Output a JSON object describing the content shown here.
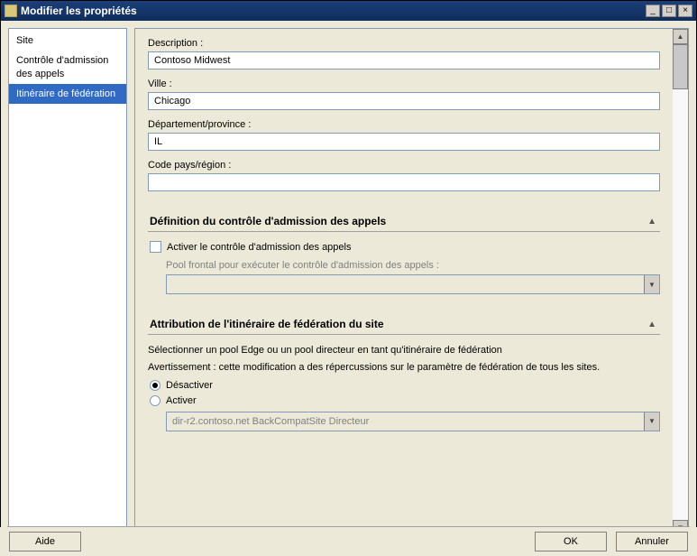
{
  "window": {
    "title": "Modifier les propriétés"
  },
  "sidebar": {
    "items": [
      {
        "label": "Site"
      },
      {
        "label": "Contrôle d'admission des appels"
      },
      {
        "label": "Itinéraire de fédération"
      }
    ]
  },
  "fields": {
    "description": {
      "label": "Description :",
      "value": "Contoso Midwest"
    },
    "city": {
      "label": "Ville :",
      "value": "Chicago"
    },
    "state": {
      "label": "Département/province :",
      "value": "IL"
    },
    "country": {
      "label": "Code pays/région :",
      "value": ""
    }
  },
  "cac": {
    "header": "Définition du contrôle d'admission des appels",
    "enable_label": "Activer le contrôle d'admission des appels",
    "pool_label": "Pool frontal pour exécuter le contrôle d'admission des appels :",
    "pool_value": ""
  },
  "fed": {
    "header": "Attribution de l'itinéraire de fédération du site",
    "info1": "Sélectionner un pool Edge ou un pool directeur en tant qu'itinéraire de fédération",
    "info2": "Avertissement : cette modification a des répercussions sur le paramètre de fédération de tous les sites.",
    "disable_label": "Désactiver",
    "enable_label": "Activer",
    "route_value": "dir-r2.contoso.net   BackCompatSite   Directeur"
  },
  "buttons": {
    "help": "Aide",
    "ok": "OK",
    "cancel": "Annuler"
  }
}
